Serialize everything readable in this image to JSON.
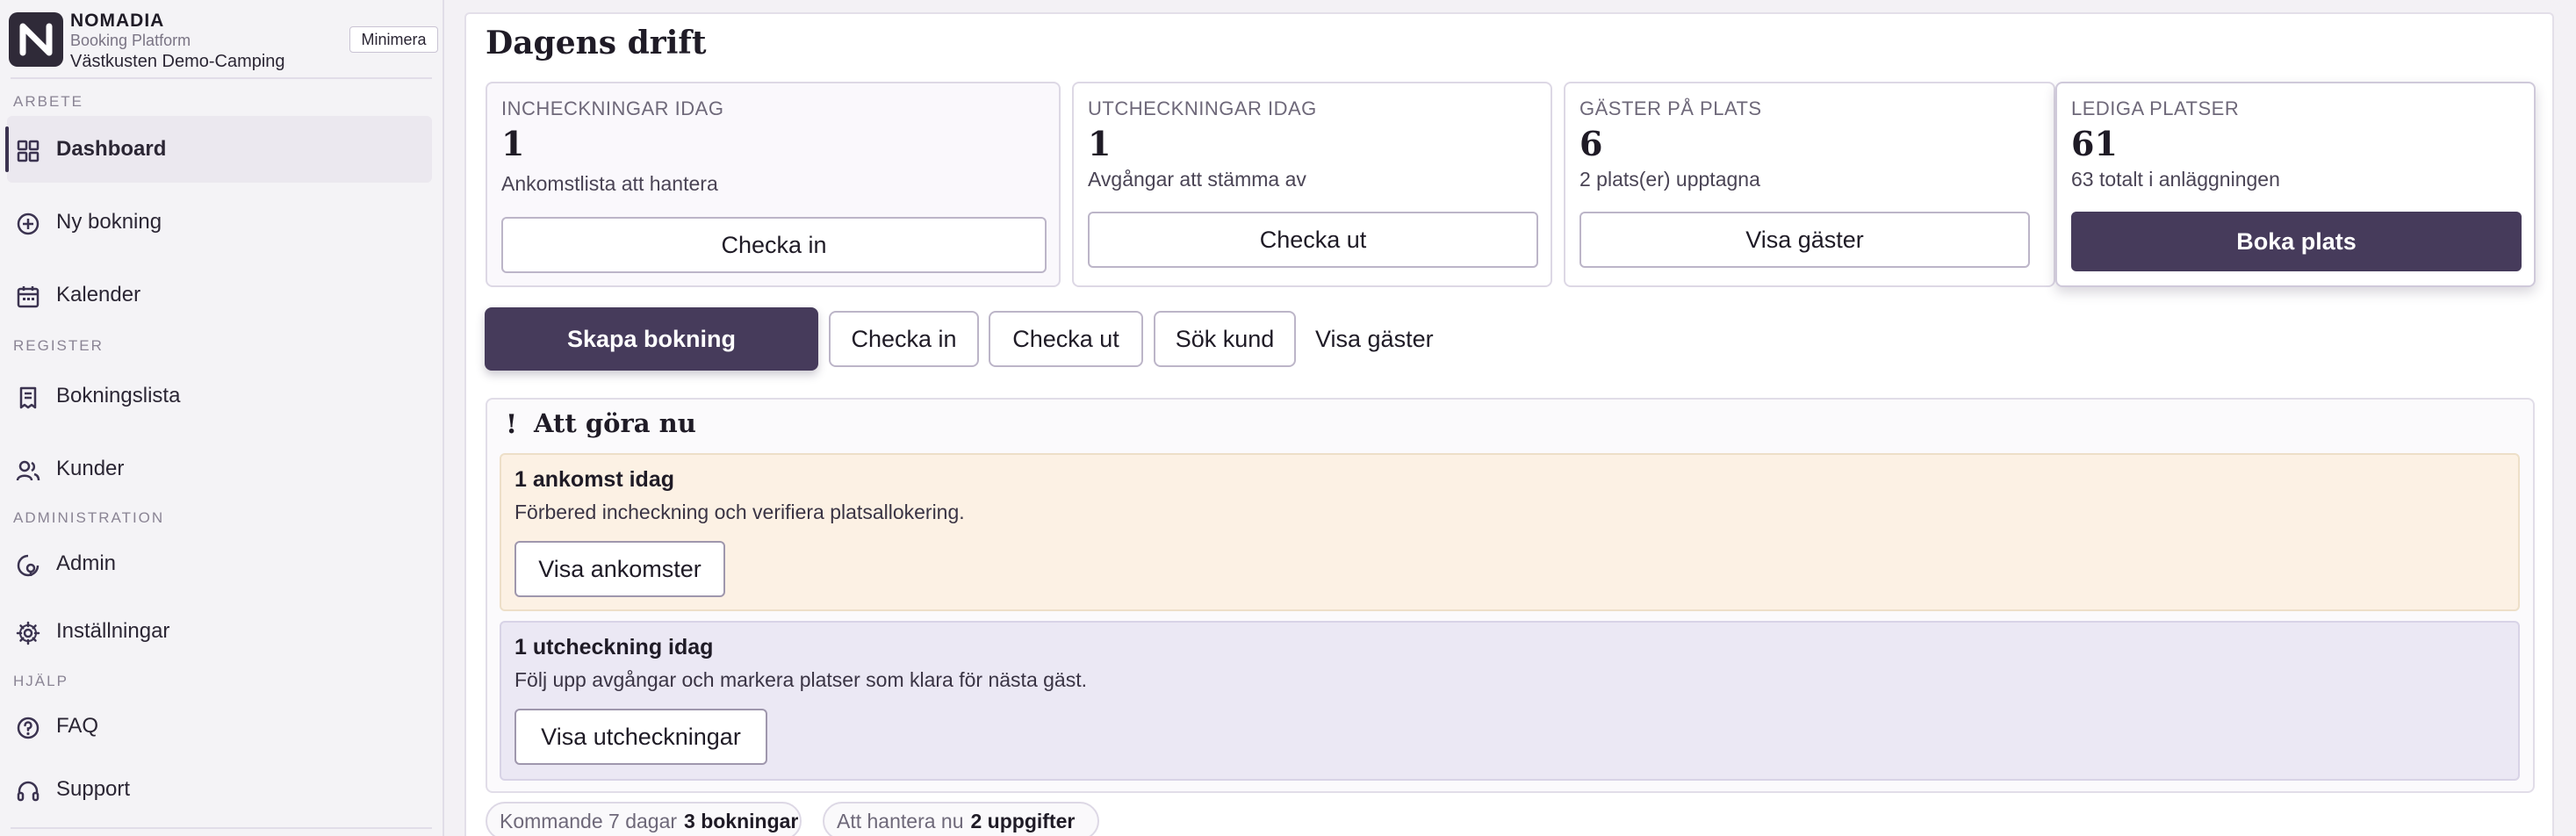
{
  "brand": {
    "name": "NOMADIA",
    "subtitle": "Booking Platform",
    "site": "Västkusten Demo-Camping",
    "minimize_label": "Minimera"
  },
  "sidebar": {
    "sections": {
      "work": "ARBETE",
      "register": "REGISTER",
      "admin": "ADMINISTRATION",
      "help": "HJÄLP"
    },
    "items": [
      {
        "label": "Dashboard",
        "icon": "dashboard-icon",
        "active": true
      },
      {
        "label": "Ny bokning",
        "icon": "plus-circle-icon"
      },
      {
        "label": "Kalender",
        "icon": "calendar-icon"
      },
      {
        "label": "Bokningslista",
        "icon": "receipt-icon"
      },
      {
        "label": "Kunder",
        "icon": "users-icon"
      },
      {
        "label": "Admin",
        "icon": "admin-icon"
      },
      {
        "label": "Inställningar",
        "icon": "gear-icon"
      },
      {
        "label": "FAQ",
        "icon": "help-circle-icon"
      },
      {
        "label": "Support",
        "icon": "headset-icon"
      }
    ]
  },
  "main": {
    "title": "Dagens drift",
    "cards": [
      {
        "label": "INCHECKNINGAR IDAG",
        "value": "1",
        "sub": "Ankomstlista att hantera",
        "button": "Checka in"
      },
      {
        "label": "UTCHECKNINGAR IDAG",
        "value": "1",
        "sub": "Avgångar att stämma av",
        "button": "Checka ut"
      },
      {
        "label": "GÄSTER PÅ PLATS",
        "value": "6",
        "sub": "2 plats(er) upptagna",
        "button": "Visa gäster"
      },
      {
        "label": "LEDIGA PLATSER",
        "value": "61",
        "sub": "63 totalt i anläggningen",
        "button": "Boka plats"
      }
    ],
    "actions": {
      "create": "Skapa bokning",
      "checkin": "Checka in",
      "checkout": "Checka ut",
      "search": "Sök kund",
      "guests": "Visa gäster"
    },
    "todo": {
      "title": "Att göra nu",
      "marker": "!",
      "tasks": [
        {
          "title": "1 ankomst idag",
          "desc": "Förbered incheckning och verifiera platsallokering.",
          "button": "Visa ankomster"
        },
        {
          "title": "1 utcheckning idag",
          "desc": "Följ upp avgångar och markera platser som klara för nästa gäst.",
          "button": "Visa utcheckningar"
        }
      ]
    },
    "pills": [
      {
        "label": "Kommande 7 dagar",
        "value": "3 bokningar"
      },
      {
        "label": "Att hantera nu",
        "value": "2 uppgifter"
      }
    ]
  },
  "colors": {
    "accent": "#463b5b",
    "arrival_bg": "#fcf1e4",
    "departure_bg": "#ebe8f4"
  }
}
